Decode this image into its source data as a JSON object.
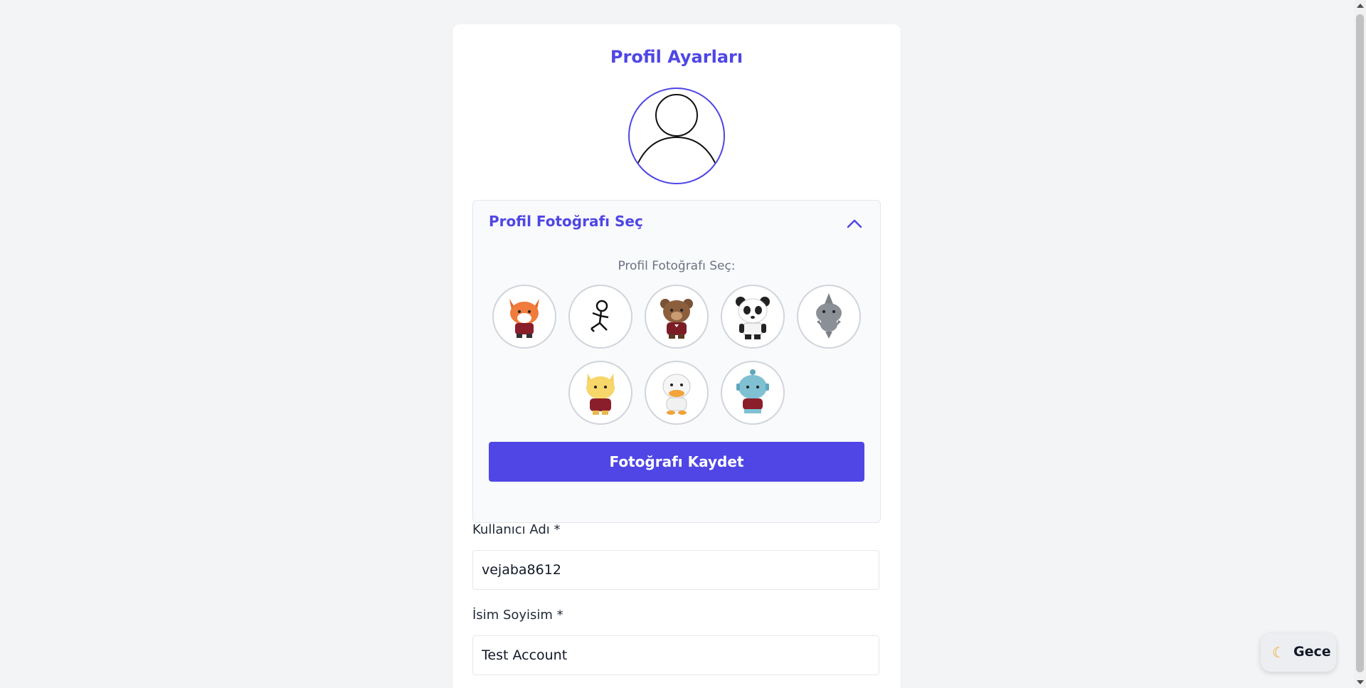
{
  "page": {
    "title": "Profil Ayarları"
  },
  "avatar": {
    "icon": "user-silhouette-icon"
  },
  "photo_panel": {
    "header": "Profil Fotoğrafı Seç",
    "chooser_label": "Profil Fotoğrafı Seç:",
    "expanded": true,
    "options": [
      {
        "icon": "fox-avatar-icon"
      },
      {
        "icon": "stick-figure-avatar-icon"
      },
      {
        "icon": "bear-avatar-icon"
      },
      {
        "icon": "panda-avatar-icon"
      },
      {
        "icon": "shark-avatar-icon"
      },
      {
        "icon": "cat-avatar-icon"
      },
      {
        "icon": "duck-avatar-icon"
      },
      {
        "icon": "fish-avatar-icon"
      }
    ],
    "save_button": "Fotoğrafı Kaydet"
  },
  "form": {
    "username": {
      "label": "Kullanıcı Adı *",
      "value": "vejaba8612"
    },
    "fullname": {
      "label": "İsim Soyisim *",
      "value": "Test Account"
    }
  },
  "theme_toggle": {
    "icon": "moon-icon",
    "label": "Gece"
  },
  "colors": {
    "accent": "#4f46e5",
    "background": "#f3f4f6"
  }
}
